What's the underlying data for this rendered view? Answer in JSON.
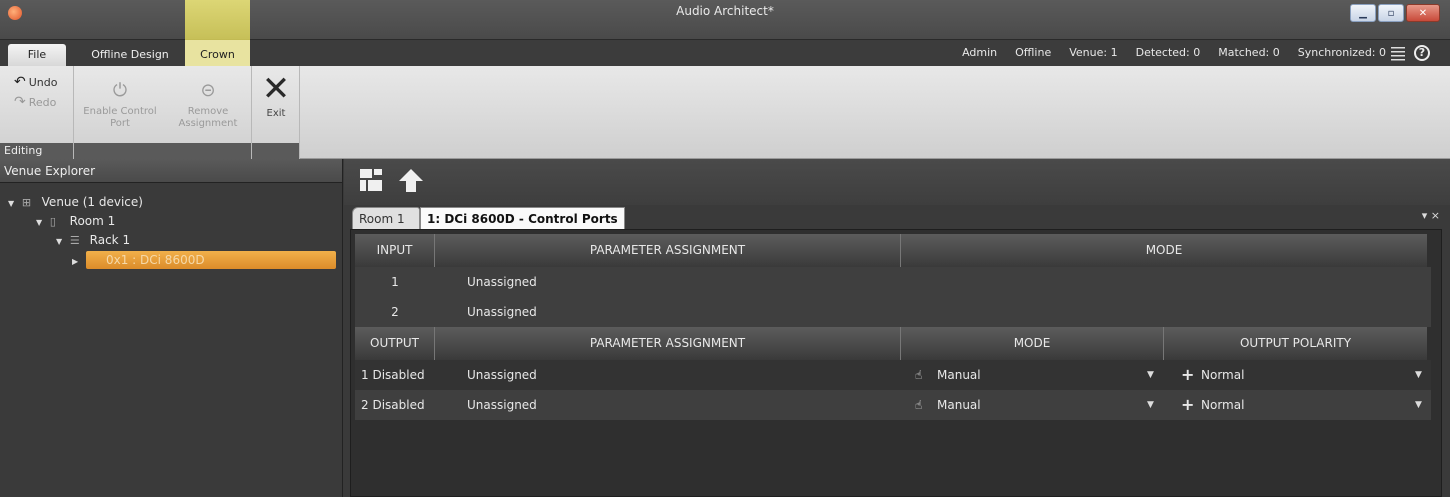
{
  "titlebar": {
    "title": "Audio Architect*"
  },
  "menu": {
    "file": "File",
    "offline_design": "Offline Design",
    "crown": "Crown"
  },
  "status": {
    "user": "Admin",
    "mode": "Offline",
    "venue": "Venue: 1",
    "detected": "Detected: 0",
    "matched": "Matched: 0",
    "synchronized": "Synchronized: 0",
    "help": "?"
  },
  "ribbon": {
    "undo": "Undo",
    "redo": "Redo",
    "enable_control_port": "Enable Control Port",
    "remove_assignment": "Remove Assignment",
    "exit": "Exit",
    "group_editing": "Editing"
  },
  "explorer": {
    "title": "Venue Explorer",
    "venue": "Venue (1 device)",
    "room": "Room 1",
    "rack": "Rack 1",
    "device": "0x1 : DCi 8600D"
  },
  "doc_tabs": {
    "room": "Room 1",
    "active": "1: DCi 8600D - Control Ports",
    "controls": "▾ ×"
  },
  "inputs": {
    "headers": [
      "INPUT",
      "PARAMETER ASSIGNMENT",
      "MODE"
    ],
    "rows": [
      {
        "num": "1",
        "assignment": "Unassigned"
      },
      {
        "num": "2",
        "assignment": "Unassigned"
      }
    ]
  },
  "outputs": {
    "headers": [
      "OUTPUT",
      "PARAMETER ASSIGNMENT",
      "MODE",
      "OUTPUT POLARITY"
    ],
    "rows": [
      {
        "label": "1  Disabled",
        "assignment": "Unassigned",
        "mode": "Manual",
        "polarity": "Normal"
      },
      {
        "label": "2  Disabled",
        "assignment": "Unassigned",
        "mode": "Manual",
        "polarity": "Normal"
      }
    ]
  },
  "colors": {
    "highlight": "#f1b04a",
    "crown_tab": "#e8e3a0"
  },
  "icons": [
    "app-logo-icon",
    "hamburger-menu-icon",
    "help-icon",
    "undo-icon",
    "redo-icon",
    "enable-port-icon",
    "remove-assignment-icon",
    "exit-x-icon",
    "layout-icon",
    "up-arrow-icon",
    "hand-pointer-icon",
    "plus-icon",
    "chevron-down-icon"
  ]
}
